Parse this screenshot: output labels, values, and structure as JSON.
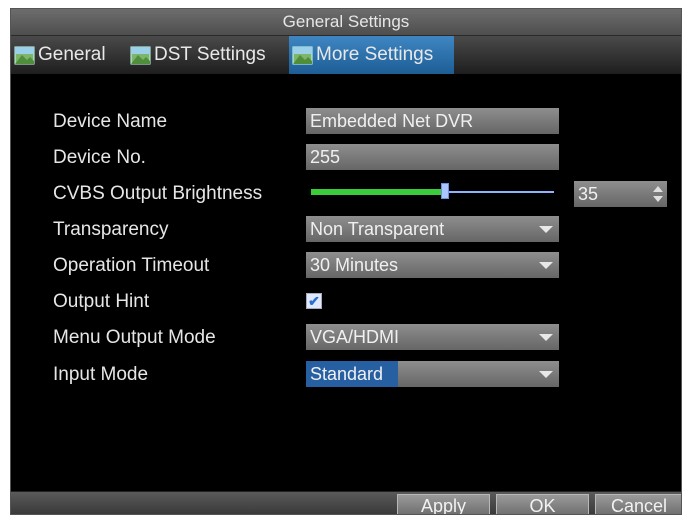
{
  "window": {
    "title": "General Settings"
  },
  "tabs": [
    {
      "label": "General",
      "icon": "settings-tab-icon"
    },
    {
      "label": "DST Settings",
      "icon": "settings-tab-icon"
    },
    {
      "label": "More Settings",
      "icon": "settings-tab-icon",
      "active": true
    }
  ],
  "fields": {
    "device_name": {
      "label": "Device Name",
      "value": "Embedded Net DVR"
    },
    "device_no": {
      "label": "Device No.",
      "value": "255"
    },
    "cvbs_brightness": {
      "label": "CVBS Output Brightness",
      "value": "35",
      "slider_fraction": 0.55
    },
    "transparency": {
      "label": "Transparency",
      "value": "Non Transparent"
    },
    "operation_timeout": {
      "label": "Operation Timeout",
      "value": "30 Minutes"
    },
    "output_hint": {
      "label": "Output Hint",
      "checked": true
    },
    "menu_output_mode": {
      "label": "Menu Output Mode",
      "value": "VGA/HDMI"
    },
    "input_mode": {
      "label": "Input Mode",
      "value": "Standard"
    }
  },
  "buttons": {
    "apply": "Apply",
    "ok": "OK",
    "cancel": "Cancel"
  },
  "colors": {
    "active_tab": "#2f74b5",
    "slider_fill": "#3bcc3b",
    "selection": "#2760a2"
  }
}
